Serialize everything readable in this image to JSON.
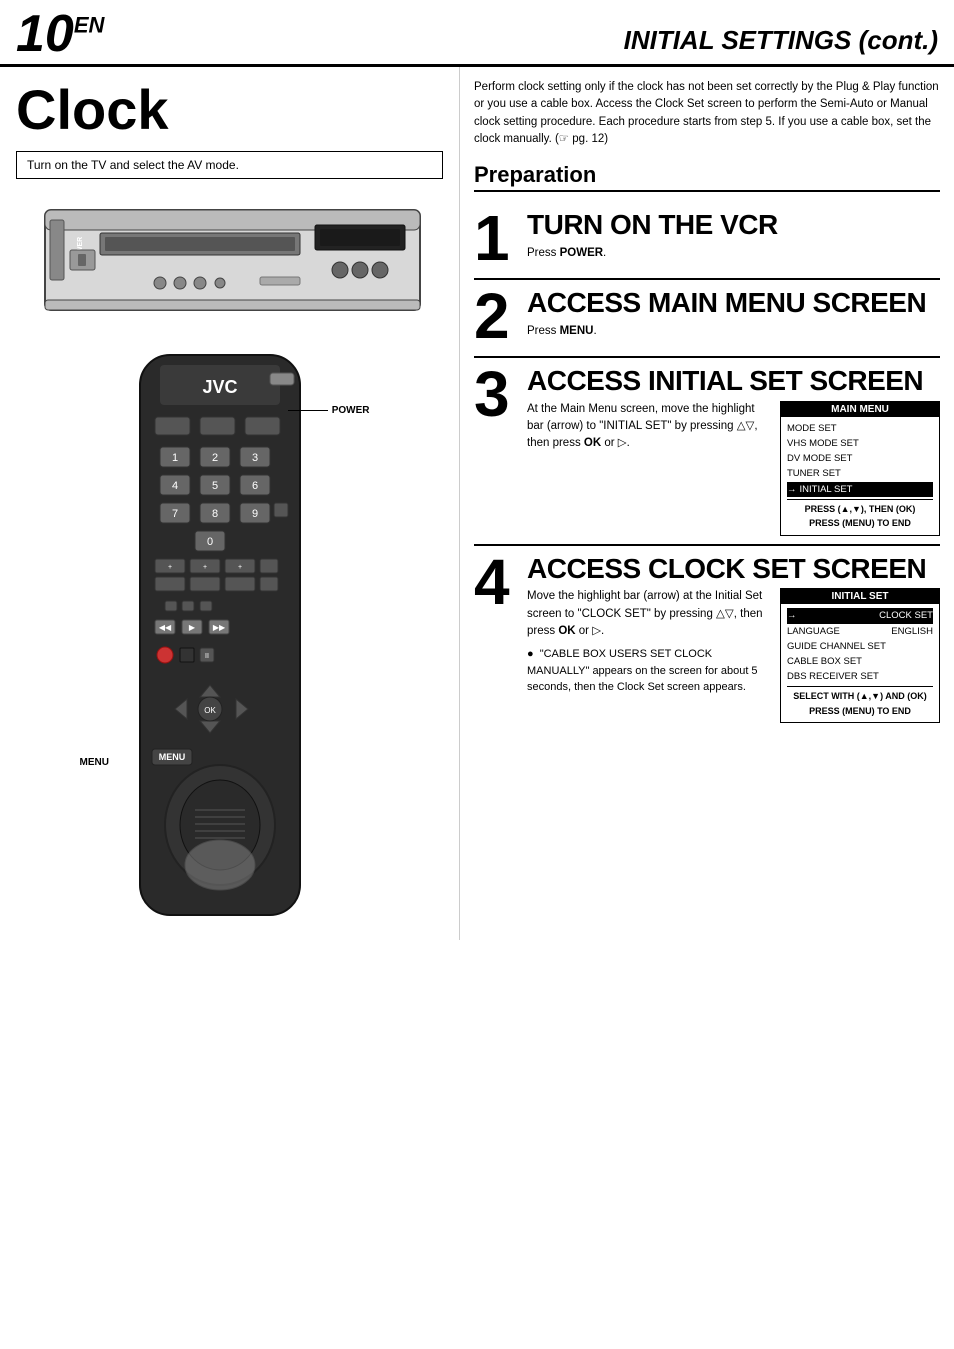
{
  "header": {
    "page_number": "10",
    "page_suffix": "EN",
    "title": "INITIAL SETTINGS (cont.)"
  },
  "left": {
    "section_title": "Clock",
    "instruction": "Turn on the TV and select the AV mode.",
    "vcr_power_label": "POWER",
    "remote_power_label": "POWER",
    "remote_menu_label": "MENU"
  },
  "right": {
    "intro_text": "Perform clock setting only if the clock has not been set correctly by the Plug & Play function or you use a cable box. Access the Clock Set screen to perform the Semi-Auto or Manual clock setting procedure. Each procedure starts from step 5. If you use a cable box, set the clock manually. (☞ pg. 12)",
    "preparation_title": "Preparation",
    "steps": [
      {
        "number": "1",
        "heading": "TURN ON THE VCR",
        "text": "Press ",
        "bold_text": "POWER",
        "text_after": "."
      },
      {
        "number": "2",
        "heading": "ACCESS MAIN MENU SCREEN",
        "text": "Press ",
        "bold_text": "MENU",
        "text_after": "."
      },
      {
        "number": "3",
        "heading": "ACCESS INITIAL SET SCREEN",
        "text": "At the Main Menu screen, move the highlight bar (arrow) to \"INITIAL SET\" by pressing △▽, then press ",
        "bold_ok": "OK",
        "text_or": " or ▷.",
        "main_menu": {
          "title": "MAIN MENU",
          "items": [
            "MODE SET",
            "VHS MODE SET",
            "DV MODE SET",
            "TUNER SET",
            "INITIAL SET"
          ],
          "selected": "INITIAL SET",
          "footer": "PRESS (▲,▼), THEN (OK)\nPRESS (MENU) TO END"
        }
      },
      {
        "number": "4",
        "heading": "ACCESS CLOCK SET SCREEN",
        "text": "Move the highlight bar (arrow) at the Initial Set screen to \"CLOCK SET\" by pressing △▽, then press ",
        "bold_ok": "OK",
        "text_or": " or ▷.",
        "initial_set": {
          "title": "INITIAL SET",
          "items": [
            {
              "label": "CLOCK SET",
              "value": "",
              "selected": true
            },
            {
              "label": "LANGUAGE",
              "value": "ENGLISH",
              "selected": false
            },
            {
              "label": "GUIDE CHANNEL SET",
              "value": "",
              "selected": false
            },
            {
              "label": "CABLE BOX SET",
              "value": "",
              "selected": false
            },
            {
              "label": "DBS RECEIVER SET",
              "value": "",
              "selected": false
            }
          ],
          "footer": "SELECT WITH (▲,▼) AND (OK)\nPRESS (MENU) TO END"
        },
        "cable_note": "\"CABLE BOX USERS SET CLOCK MANUALLY\" appears on the screen for about 5 seconds, then the Clock Set screen appears."
      }
    ]
  }
}
